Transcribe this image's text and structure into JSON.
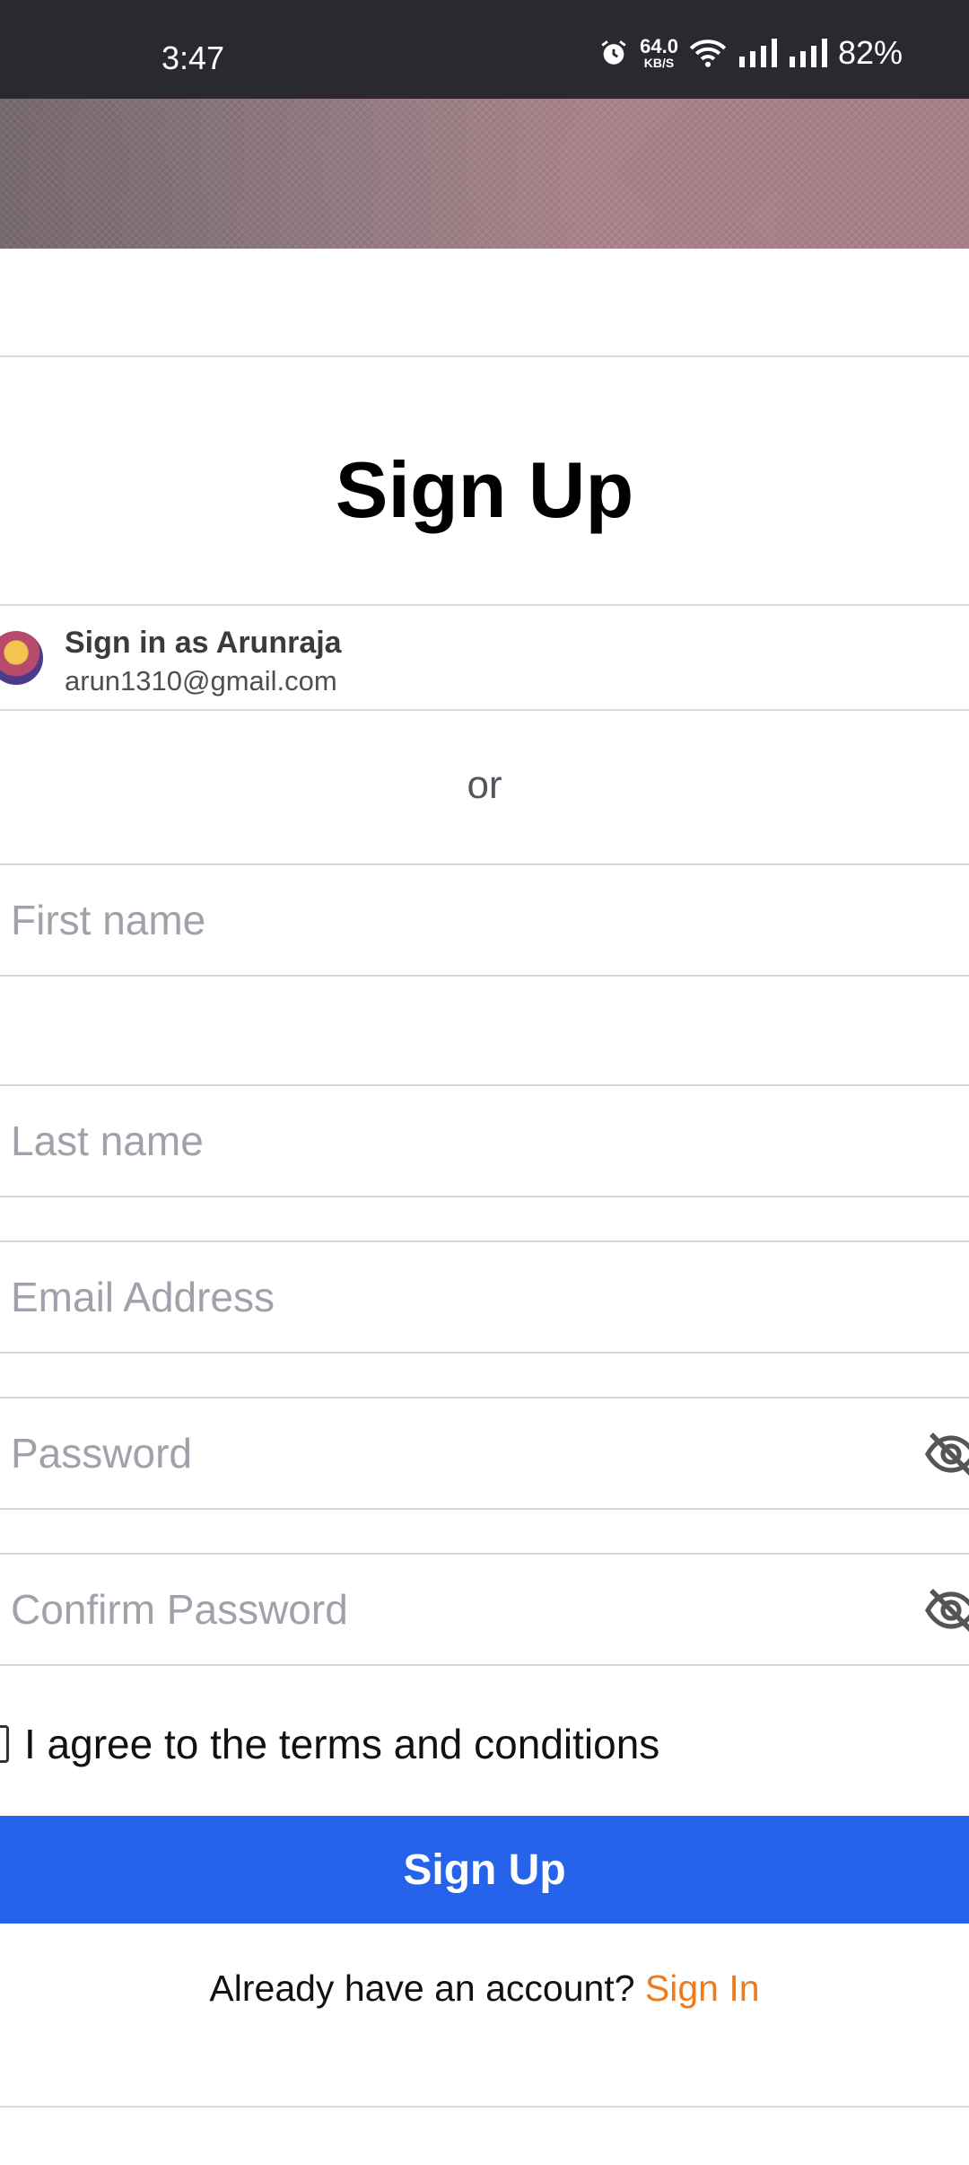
{
  "status_bar": {
    "time": "3:47",
    "net_speed_value": "64.0",
    "net_speed_unit": "KB/S",
    "battery": "82%",
    "icons": [
      "alarm-icon",
      "wifi-icon",
      "signal-icon",
      "signal-icon"
    ]
  },
  "page": {
    "title": "Sign Up"
  },
  "google_account": {
    "label": "Sign in as Arunraja",
    "email": "arun1310@gmail.com"
  },
  "divider_text": "or",
  "form": {
    "first_name_placeholder": "First name",
    "last_name_placeholder": "Last name",
    "email_placeholder": "Email Address",
    "password_placeholder": "Password",
    "confirm_password_placeholder": "Confirm Password",
    "terms_label": "I agree to the terms and conditions",
    "submit_label": "Sign Up"
  },
  "footer": {
    "prompt": "Already have an account?",
    "link": "Sign In"
  },
  "colors": {
    "primary": "#2563eb",
    "link": "#f07b1c",
    "status_bar": "#2a2930"
  }
}
